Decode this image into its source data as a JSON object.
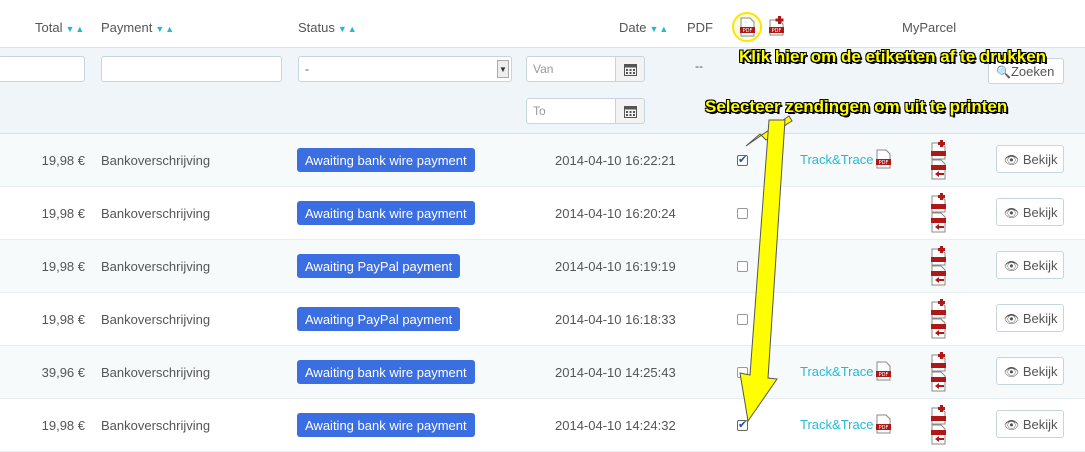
{
  "header": {
    "total": "Total",
    "payment": "Payment",
    "status": "Status",
    "date": "Date",
    "pdf": "PDF",
    "myparcel": "MyParcel",
    "sort_glyph": "▼▲"
  },
  "filters": {
    "status_value": "-",
    "date_from_placeholder": "Van",
    "date_to_placeholder": "To",
    "pdf_dash": "--",
    "search_label": "Zoeken"
  },
  "annotations": {
    "top": "Klik hier om de etiketten af te drukken",
    "mid": "Selecteer zendingen om uit te printen",
    "color": "#ffff00"
  },
  "rows": [
    {
      "total": "19,98 €",
      "payment": "Bankoverschrijving",
      "status": "Awaiting bank wire payment",
      "date": "2014-04-10 16:22:21",
      "checked": true,
      "track": "Track&Trace",
      "view": "Bekijk"
    },
    {
      "total": "19,98 €",
      "payment": "Bankoverschrijving",
      "status": "Awaiting bank wire payment",
      "date": "2014-04-10 16:20:24",
      "checked": false,
      "track": "",
      "view": "Bekijk"
    },
    {
      "total": "19,98 €",
      "payment": "Bankoverschrijving",
      "status": "Awaiting PayPal payment",
      "date": "2014-04-10 16:19:19",
      "checked": false,
      "track": "",
      "view": "Bekijk"
    },
    {
      "total": "19,98 €",
      "payment": "Bankoverschrijving",
      "status": "Awaiting PayPal payment",
      "date": "2014-04-10 16:18:33",
      "checked": false,
      "track": "",
      "view": "Bekijk"
    },
    {
      "total": "39,96 €",
      "payment": "Bankoverschrijving",
      "status": "Awaiting bank wire payment",
      "date": "2014-04-10 14:25:43",
      "checked": false,
      "track": "Track&Trace",
      "view": "Bekijk"
    },
    {
      "total": "19,98 €",
      "payment": "Bankoverschrijving",
      "status": "Awaiting bank wire payment",
      "date": "2014-04-10 14:24:32",
      "checked": true,
      "track": "Track&Trace",
      "view": "Bekijk"
    }
  ],
  "colors": {
    "accent": "#25b9d7",
    "badge": "#3b6ee0",
    "pdf_red": "#b01818"
  }
}
